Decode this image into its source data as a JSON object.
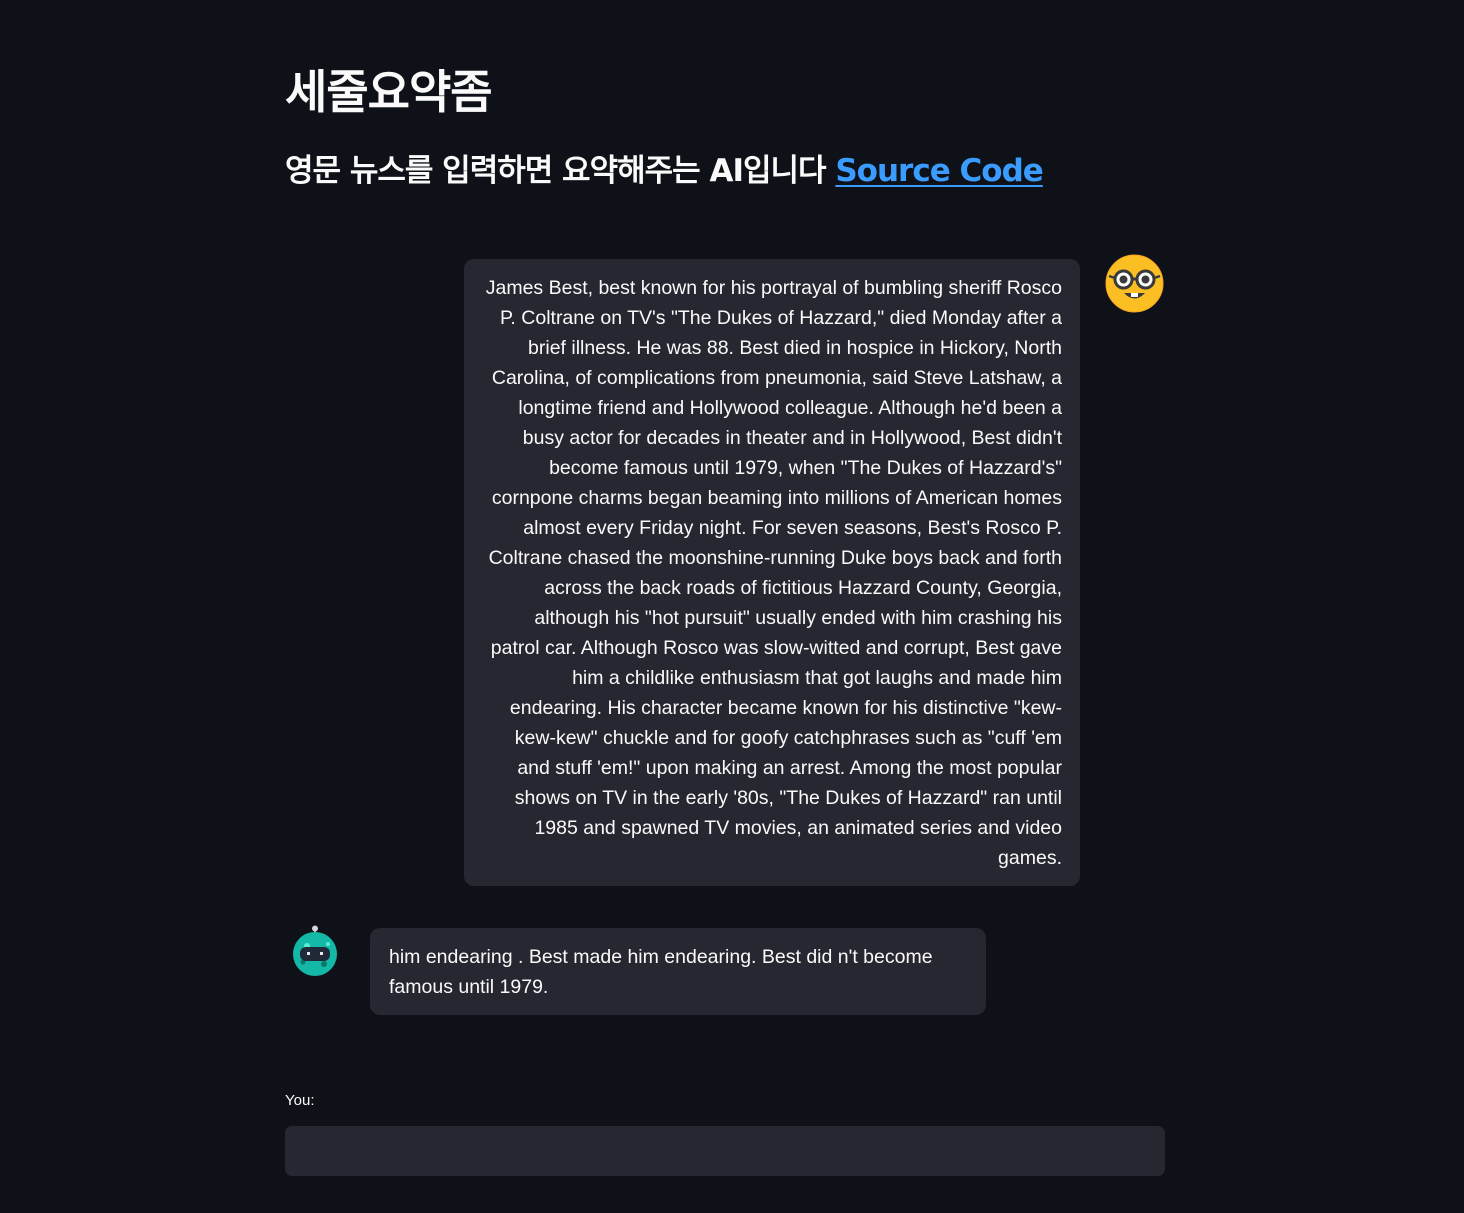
{
  "header": {
    "title": "세줄요약좀",
    "subtitle": "영문 뉴스를 입력하면 요약해주는 AI입니다",
    "source_link_label": "Source Code"
  },
  "chat": {
    "messages": [
      {
        "role": "user",
        "avatar_icon": "nerd-face-emoji-icon",
        "text": "James Best, best known for his portrayal of bumbling sheriff Rosco P. Coltrane on TV's \"The Dukes of Hazzard,\" died Monday after a brief illness. He was 88. Best died in hospice in Hickory, North Carolina, of complications from pneumonia, said Steve Latshaw, a longtime friend and Hollywood colleague. Although he'd been a busy actor for decades in theater and in Hollywood, Best didn't become famous until 1979, when \"The Dukes of Hazzard's\" cornpone charms began beaming into millions of American homes almost every Friday night. For seven seasons, Best's Rosco P. Coltrane chased the moonshine-running Duke boys back and forth across the back roads of fictitious Hazzard County, Georgia, although his \"hot pursuit\" usually ended with him crashing his patrol car. Although Rosco was slow-witted and corrupt, Best gave him a childlike enthusiasm that got laughs and made him endearing. His character became known for his distinctive \"kew-kew-kew\" chuckle and for goofy catchphrases such as \"cuff 'em and stuff 'em!\" upon making an arrest. Among the most popular shows on TV in the early '80s, \"The Dukes of Hazzard\" ran until 1985 and spawned TV movies, an animated series and video games."
      },
      {
        "role": "bot",
        "avatar_icon": "robot-avatar-icon",
        "text": "him endearing . Best made him endearing. Best did n't become famous until 1979."
      }
    ]
  },
  "input": {
    "label": "You:",
    "value": ""
  },
  "colors": {
    "background": "#0e1117",
    "bubble": "#262730",
    "text": "#fafafa",
    "link": "#3b9cff",
    "user_avatar": "#fbbf24",
    "bot_avatar": "#14b8a6"
  }
}
